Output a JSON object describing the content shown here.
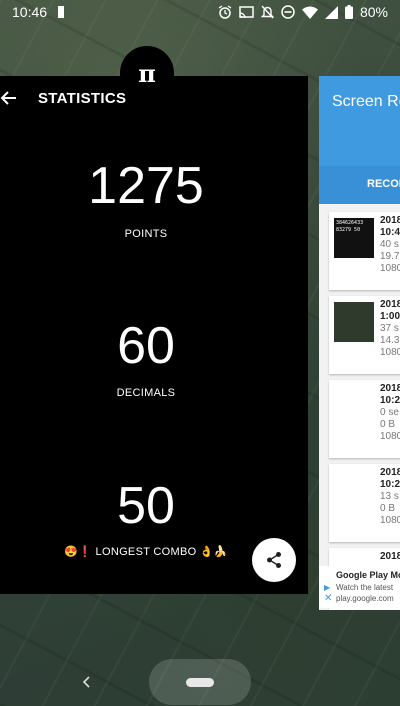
{
  "status_bar": {
    "time": "10:46",
    "battery": "80%"
  },
  "stats_app": {
    "icon_glyph": "π",
    "title": "STATISTICS",
    "stats": [
      {
        "value": "1275",
        "label": "POINTS"
      },
      {
        "value": "60",
        "label": "DECIMALS"
      },
      {
        "value": "50",
        "label": "😍❗ LONGEST COMBO 👌🍌"
      }
    ]
  },
  "recorder_app": {
    "title": "Screen Recorder",
    "tab": "RECORDINGS",
    "items": [
      {
        "date": "2018",
        "time": "10:4",
        "duration": "40 s",
        "size": "19.7",
        "resolution": "1080",
        "thumb_text": "384626433 83279 50"
      },
      {
        "date": "2018",
        "time": "1:00",
        "duration": "37 s",
        "size": "14.3",
        "resolution": "1080",
        "thumb_text": ""
      },
      {
        "date": "2018",
        "time": "10:2",
        "duration": "0 se",
        "size": "0 B",
        "resolution": "1080",
        "thumb_text": ""
      },
      {
        "date": "2018",
        "time": "10:2",
        "duration": "13 s",
        "size": "0 B",
        "resolution": "1080",
        "thumb_text": ""
      },
      {
        "date": "2018",
        "time": "",
        "duration": "",
        "size": "",
        "resolution": "",
        "thumb_text": ""
      }
    ],
    "ad": {
      "title": "Google Play Movies",
      "line1": "Watch the latest",
      "line2": "play.google.com"
    }
  }
}
